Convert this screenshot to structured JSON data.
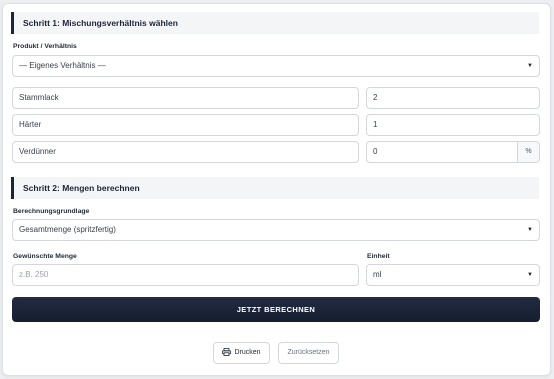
{
  "step1": {
    "title": "Schritt 1: Mischungsverhältnis wählen",
    "product_label": "Produkt / Verhältnis",
    "product_value": "— Eigenes Verhältnis —",
    "rows": [
      {
        "name": "Stammlack",
        "value": "2"
      },
      {
        "name": "Härter",
        "value": "1"
      },
      {
        "name": "Verdünner",
        "value": "0",
        "unit": "%"
      }
    ]
  },
  "step2": {
    "title": "Schritt 2: Mengen berechnen",
    "basis_label": "Berechnungsgrundlage",
    "basis_value": "Gesamtmenge (spritzfertig)",
    "amount_label": "Gewünschte Menge",
    "amount_placeholder": "z.B. 250",
    "unit_label": "Einheit",
    "unit_value": "ml"
  },
  "actions": {
    "calculate": "JETZT BERECHNEN",
    "print": "Drucken",
    "reset": "Zurücksetzen"
  },
  "icons": {
    "select_arrow": "caret-down-icon",
    "print": "printer-icon"
  }
}
